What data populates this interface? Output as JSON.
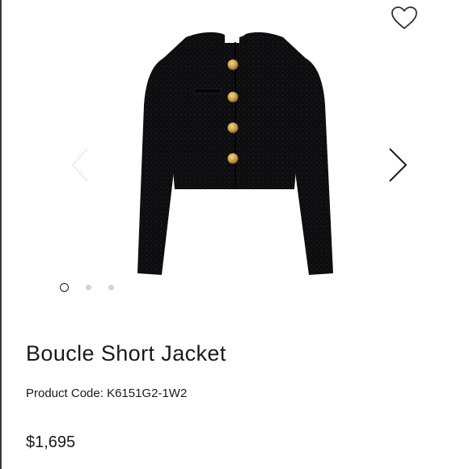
{
  "product": {
    "title": "Boucle Short Jacket",
    "code_label": "Product Code:",
    "code_value": "K6151G2-1W2",
    "price": "$1,695",
    "image": "black boucle cropped jacket with gold buttons"
  },
  "gallery": {
    "slide_count": 3,
    "active_slide": 1
  },
  "icons": {
    "wishlist": "heart-outline-icon",
    "previous": "chevron-left-icon",
    "next": "chevron-right-icon"
  },
  "colors": {
    "jacket": "#0d0d0f",
    "buttons": "#c9a24a",
    "text": "#1a1a1a",
    "inactive_dot": "#d3d3d3"
  }
}
